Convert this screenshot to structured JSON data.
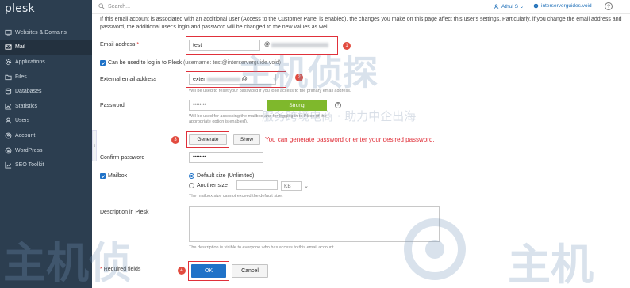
{
  "sidebar": {
    "logo": "plesk",
    "items": [
      {
        "label": "Websites & Domains",
        "icon": "monitor-icon"
      },
      {
        "label": "Mail",
        "icon": "mail-icon",
        "active": true
      },
      {
        "label": "Applications",
        "icon": "gear-icon"
      },
      {
        "label": "Files",
        "icon": "folder-icon"
      },
      {
        "label": "Databases",
        "icon": "database-icon"
      },
      {
        "label": "Statistics",
        "icon": "chart-icon"
      },
      {
        "label": "Users",
        "icon": "user-icon"
      },
      {
        "label": "Account",
        "icon": "account-icon"
      },
      {
        "label": "WordPress",
        "icon": "wordpress-icon"
      },
      {
        "label": "SEO Toolkit",
        "icon": "seo-icon"
      }
    ],
    "collapse_glyph": "‹"
  },
  "topbar": {
    "search_placeholder": "Search...",
    "user_label": "Athul S ⌄",
    "domain_label": "interserverguides.void",
    "help_glyph": "?"
  },
  "info_text": "If this email account is associated with an additional user (Access to the Customer Panel is enabled), the changes you make on this page affect this user's settings. Particularly, if you change the email address and password, the additional user's login and password will be changed to the new values as well.",
  "form": {
    "email_label": "Email address",
    "required_star": "*",
    "email_value": "test",
    "at_sign": "@",
    "login_checkbox_label": "Can be used to log in to Plesk",
    "login_checkbox_note": "(username: test@interserverguide.void)",
    "external_label": "External email address",
    "external_value": "exter",
    "external_suffix": "@r",
    "external_hint": "Will be used to reset your password if you lose access to the primary email address.",
    "password_label": "Password",
    "password_value": "••••••••",
    "strength_label": "Strong",
    "password_hint": "Will be used for accessing the mailbox and for logging in to Plesk (if the appropriate option is enabled).",
    "generate_label": "Generate",
    "show_label": "Show",
    "annotation": "You can generate password or enter your desired password.",
    "confirm_label": "Confirm password",
    "confirm_value": "••••••••",
    "mailbox_label": "Mailbox",
    "default_size_label": "Default size (Unlimited)",
    "another_size_label": "Another size",
    "unit_label": "KB",
    "mailbox_hint": "The mailbox size cannot exceed the default size.",
    "description_label": "Description in Plesk",
    "description_hint": "The description is visible to everyone who has access to this email account.",
    "required_fields": "Required fields",
    "ok_label": "OK",
    "cancel_label": "Cancel"
  },
  "markers": {
    "m1": "1",
    "m2": "2",
    "m3": "3",
    "m4": "4"
  },
  "watermarks": {
    "cn_main_1": "主机侦探",
    "cn_sub_1": "服务跨境电商 · 助力中企出海",
    "cn_main_2": "主机侦",
    "cn_main_3": "主机"
  },
  "colors": {
    "accent": "#1f72c8",
    "annotation": "#e0303a",
    "sidebar": "#2c3e50",
    "strength": "#7fb82c"
  }
}
